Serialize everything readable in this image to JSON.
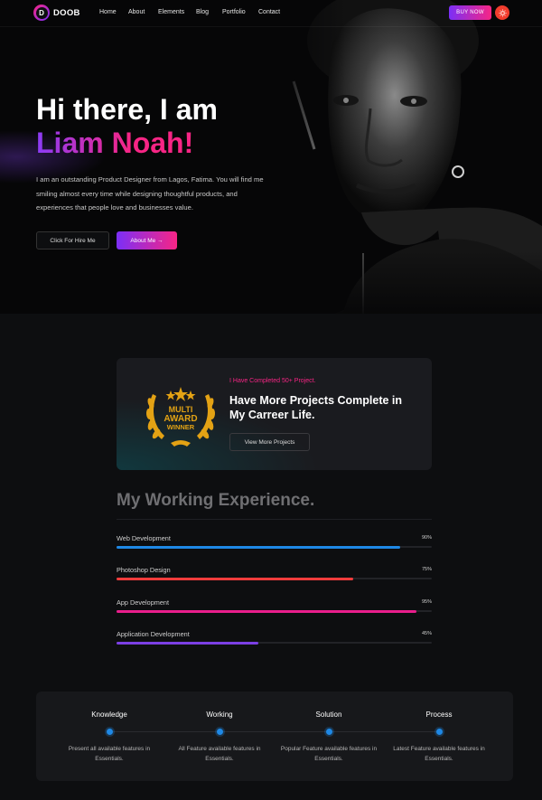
{
  "header": {
    "logo_letter": "D",
    "logo_text": "DOOB",
    "nav": [
      "Home",
      "About",
      "Elements",
      "Blog",
      "Portfolio",
      "Contact"
    ],
    "buy_label": "BUY NOW",
    "theme_icon": "sun-icon"
  },
  "hero": {
    "greeting": "Hi there, I am",
    "name": "Liam Noah!",
    "description": "I am an outstanding Product Designer from Lagos, Fatima. You will find me smiling almost every time while designing thoughtful products, and experiences that people love and businesses value.",
    "hire_label": "Click For Hire Me",
    "about_label": "About Me →"
  },
  "award": {
    "badge_line1": "MULTI",
    "badge_line2": "AWARD",
    "badge_line3": "WINNER",
    "kicker": "I Have Completed 50+ Project.",
    "title": "Have More Projects Complete in My Carreer Life.",
    "button": "View More Projects"
  },
  "experience": {
    "title": "My Working Experience.",
    "skills": [
      {
        "name": "Web Development",
        "percent_label": "90%",
        "percent": 90,
        "color": "#1e88e5"
      },
      {
        "name": "Photoshop Design",
        "percent_label": "75%",
        "percent": 75,
        "color": "#f23c3c"
      },
      {
        "name": "App Development",
        "percent_label": "95%",
        "percent": 95,
        "color": "#e91e8c"
      },
      {
        "name": "Application Development",
        "percent_label": "45%",
        "percent": 45,
        "color": "#7b3fe4"
      }
    ]
  },
  "process": {
    "steps": [
      {
        "title": "Knowledge",
        "desc": "Present all available features in Essentials."
      },
      {
        "title": "Working",
        "desc": "All Feature available features in Essentials."
      },
      {
        "title": "Solution",
        "desc": "Popular Feature available features in Essentials."
      },
      {
        "title": "Process",
        "desc": "Latest Feature available features in Essentials."
      }
    ]
  }
}
